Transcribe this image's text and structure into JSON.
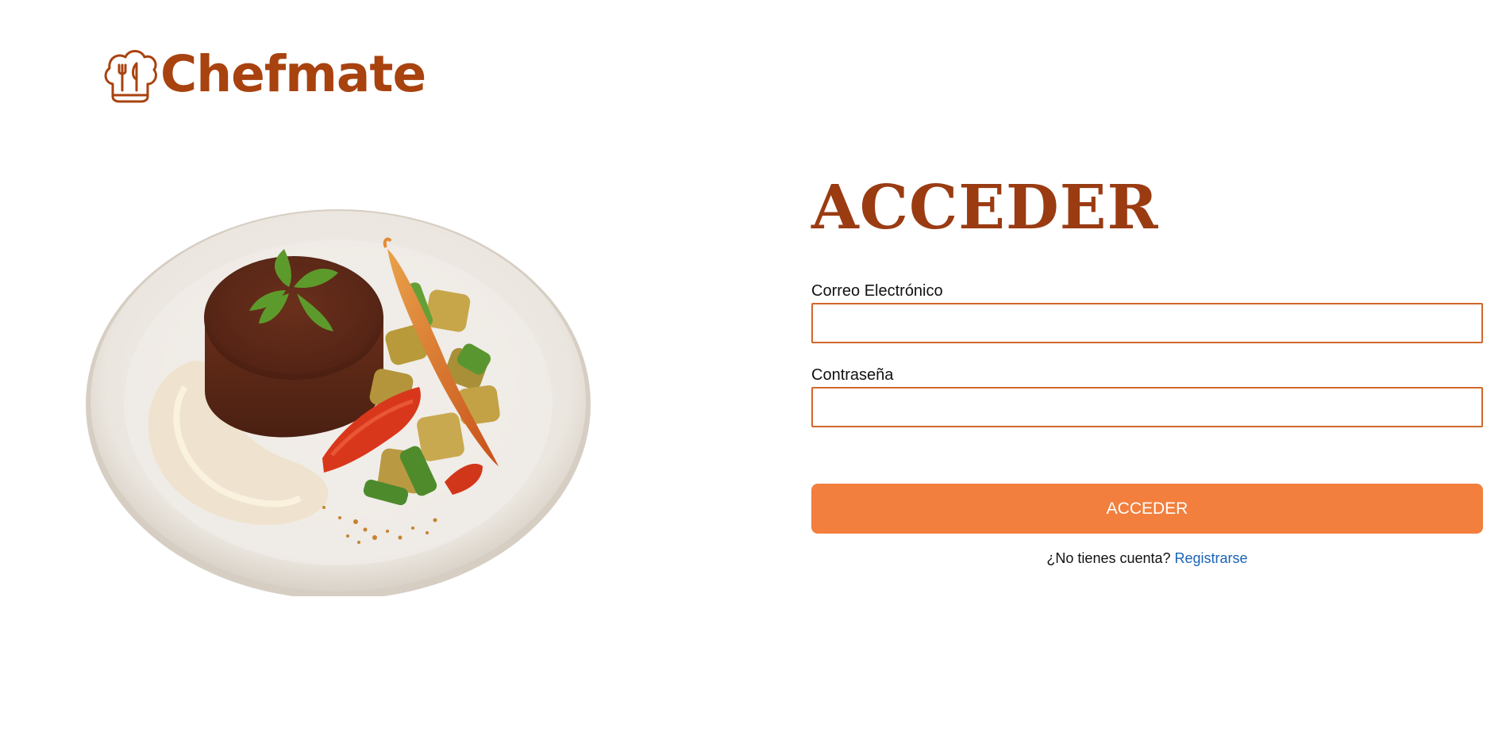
{
  "brand": {
    "name": "Chefmate",
    "logo_icon": "chef-hat-utensils-icon",
    "color": "#a8420f"
  },
  "hero": {
    "image": "plate-steak-vegetables-image"
  },
  "login": {
    "title": "ACCEDER",
    "email_label": "Correo Electrónico",
    "email_value": "",
    "password_label": "Contraseña",
    "password_value": "",
    "submit_label": "ACCEDER",
    "no_account_text": "¿No tienes cuenta?",
    "register_link": "Registrarse"
  },
  "colors": {
    "title": "#9a3b12",
    "input_border": "#d0672a",
    "button": "#f27f3d",
    "link": "#1a63b5"
  }
}
